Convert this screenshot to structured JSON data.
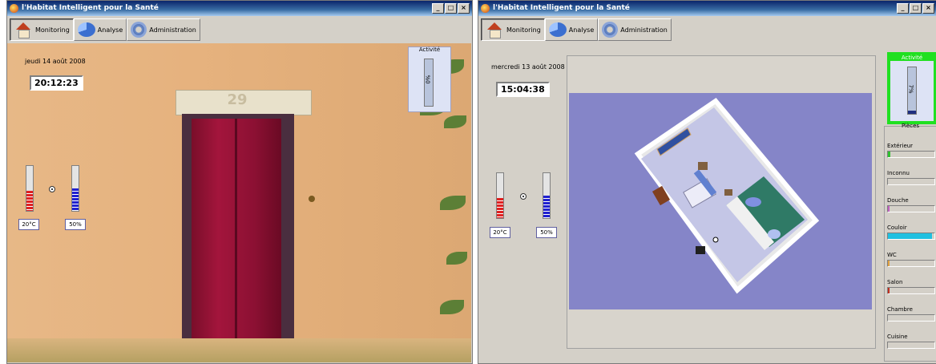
{
  "left": {
    "title": "l'Habitat Intelligent pour la Santé",
    "window_buttons": [
      "_",
      "□",
      "×"
    ],
    "tabs": [
      {
        "label": "Monitoring",
        "icon": "home-icon",
        "selected": true
      },
      {
        "label": "Analyse",
        "icon": "pie-icon",
        "selected": false
      },
      {
        "label": "Administration",
        "icon": "gear-icon",
        "selected": false
      }
    ],
    "date": "jeudi 14 août 2008",
    "time": "20:12:23",
    "temperature": "20°C",
    "humidity": "50%",
    "temperature_fill": 0.45,
    "humidity_fill": 0.5,
    "activity_label": "Activité",
    "activity_value": "%0",
    "door_number": "29"
  },
  "right": {
    "title": "l'Habitat Intelligent pour la Santé",
    "window_buttons": [
      "_",
      "□",
      "×"
    ],
    "tabs": [
      {
        "label": "Monitoring",
        "icon": "home-icon",
        "selected": true
      },
      {
        "label": "Analyse",
        "icon": "pie-icon",
        "selected": false
      },
      {
        "label": "Administration",
        "icon": "gear-icon",
        "selected": false
      }
    ],
    "date": "mercredi 13 août 2008",
    "time": "15:04:38",
    "temperature": "20°C",
    "humidity": "50%",
    "temperature_fill": 0.45,
    "humidity_fill": 0.5,
    "activity_label": "Activité",
    "activity_value": "7%",
    "activity_fill": 0.07,
    "pieces_label": "Pièces",
    "rooms": [
      {
        "name": "Extérieur",
        "level": 0.05,
        "color": "#30c030"
      },
      {
        "name": "Inconnu",
        "level": 0,
        "color": "#c0c0c0"
      },
      {
        "name": "Douche",
        "level": 0.03,
        "color": "#c060c0"
      },
      {
        "name": "Couloir",
        "level": 0.95,
        "color": "#20c0e0"
      },
      {
        "name": "WC",
        "level": 0.04,
        "color": "#e0a040"
      },
      {
        "name": "Salon",
        "level": 0.03,
        "color": "#c03020"
      },
      {
        "name": "Chambre",
        "level": 0,
        "color": "#c0c0c0"
      },
      {
        "name": "Cuisine",
        "level": 0,
        "color": "#c0c0c0"
      }
    ],
    "accent_green": "#20e020"
  }
}
